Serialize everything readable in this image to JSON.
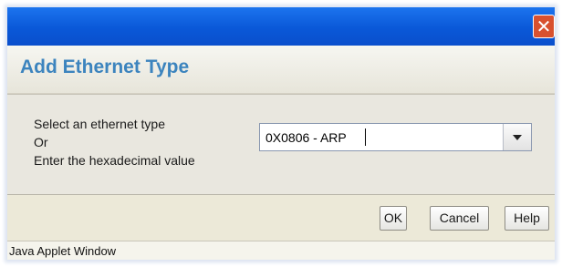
{
  "window": {
    "close_symbol": "✕"
  },
  "dialog": {
    "title": "Add Ethernet Type"
  },
  "form": {
    "label_lines": [
      "Select an ethernet type",
      "Or",
      "Enter the hexadecimal value"
    ],
    "ethernet_type_value": "0X0806 - ARP"
  },
  "buttons": {
    "ok": "OK",
    "cancel": "Cancel",
    "help": "Help"
  },
  "status_bar": {
    "text": "Java Applet Window"
  },
  "icons": {
    "close": "close-icon",
    "dropdown": "chevron-down-icon"
  },
  "colors": {
    "title_text": "#3c84be",
    "titlebar": "#0a58d8",
    "close_button": "#d8512f"
  }
}
